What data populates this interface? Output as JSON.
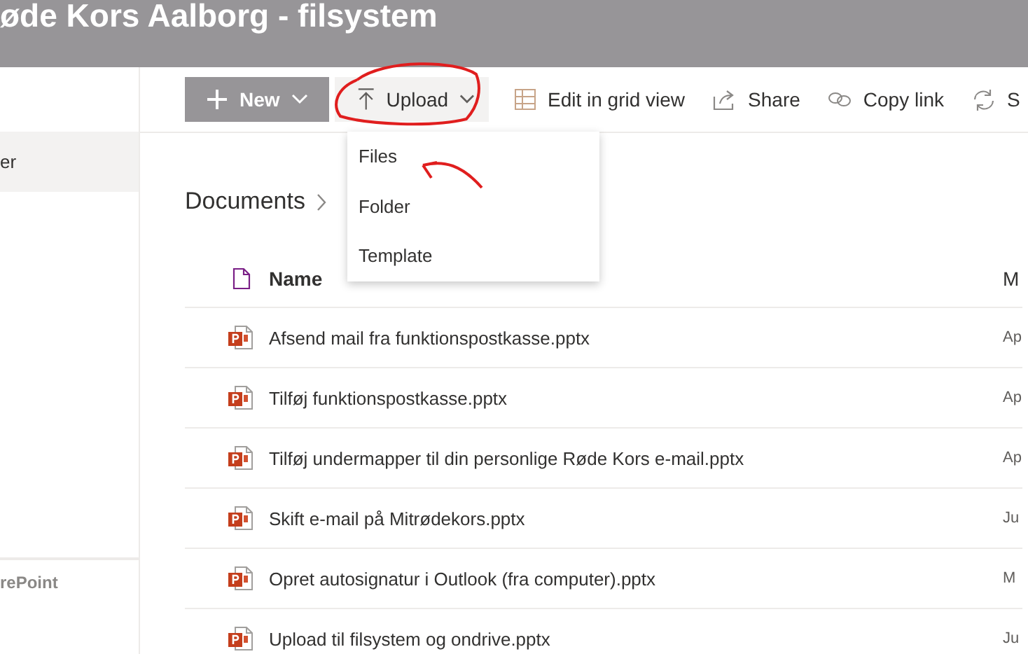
{
  "site_title": "øde Kors Aalborg - filsystem",
  "sidebar": {
    "items": [
      {
        "label": "er",
        "selected": true
      }
    ],
    "footer": "rePoint"
  },
  "command_bar": [
    {
      "kind": "primary",
      "label": "New"
    },
    {
      "kind": "menu",
      "label": "Upload"
    },
    {
      "kind": "plain",
      "label": "Edit in grid view"
    },
    {
      "kind": "plain",
      "label": "Share"
    },
    {
      "kind": "plain",
      "label": "Copy link"
    },
    {
      "kind": "plain",
      "label": "S"
    }
  ],
  "upload_menu": [
    "Files",
    "Folder",
    "Template"
  ],
  "breadcrumb": [
    "Documents"
  ],
  "table": {
    "columns": [
      "Name",
      "M"
    ],
    "rows": [
      {
        "name": "Afsend mail fra funktionspostkasse.pptx",
        "column_2": "Ap"
      },
      {
        "name": "Tilføj funktionspostkasse.pptx",
        "column_2": "Ap"
      },
      {
        "name": "Tilføj undermapper til din personlige Røde Kors e-mail.pptx",
        "column_2": "Ap"
      },
      {
        "name": "Skift e-mail på Mitrødekors.pptx",
        "column_2": "Ju"
      },
      {
        "name": "Opret autosignatur i Outlook (fra computer).pptx",
        "column_2": "M"
      },
      {
        "name": "Upload til filsystem og ondrive.pptx",
        "column_2": "Ju"
      }
    ]
  }
}
